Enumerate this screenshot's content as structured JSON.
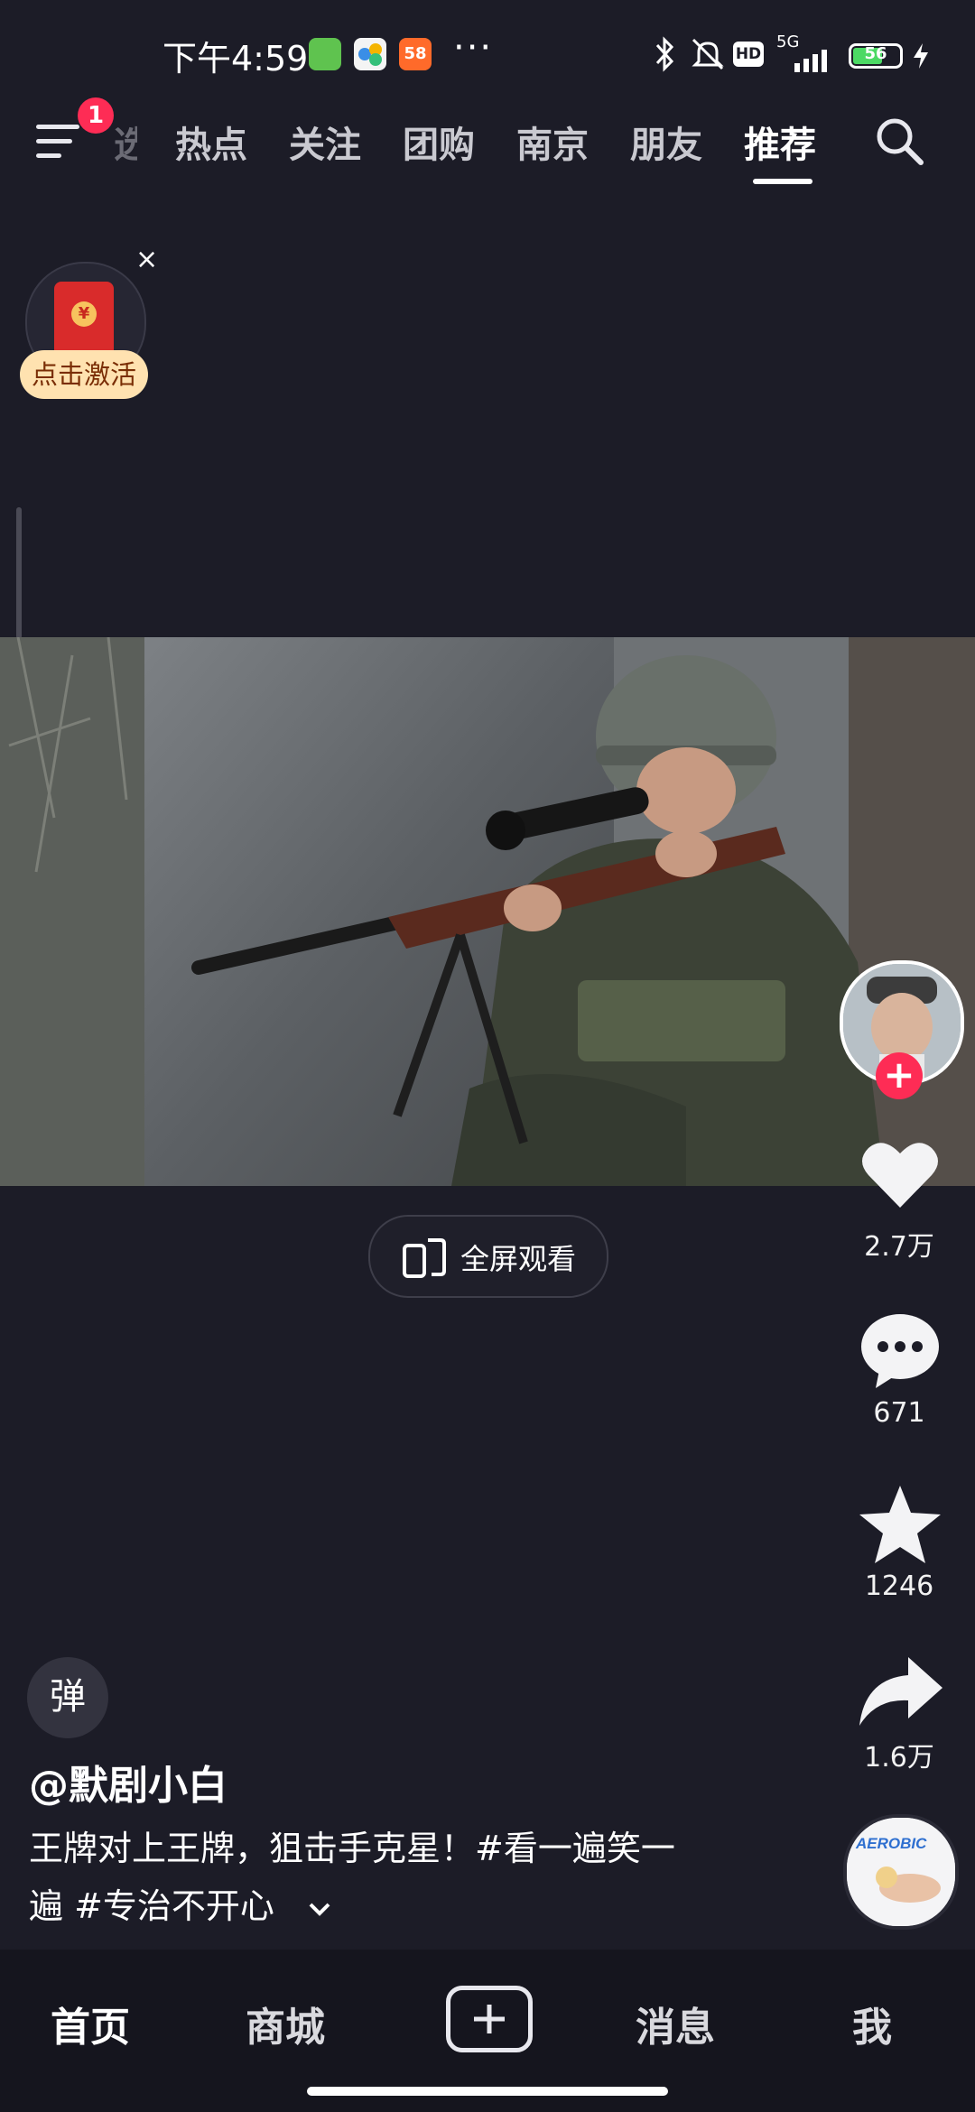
{
  "status_bar": {
    "time": "下午4:59",
    "battery": "56",
    "network": "5G",
    "hd": "HD",
    "more": "···"
  },
  "top_nav": {
    "menu_badge": "1",
    "partial_tab": "选",
    "tabs": [
      "热点",
      "关注",
      "团购",
      "南京",
      "朋友",
      "推荐"
    ],
    "active_tab": "推荐"
  },
  "red_packet": {
    "label": "点击激活",
    "close": "×",
    "coin": "¥"
  },
  "video": {
    "fullscreen_label": "全屏观看"
  },
  "actions": {
    "likes": "2.7万",
    "comments": "671",
    "favorites": "1246",
    "shares": "1.6万",
    "follow": "+"
  },
  "post": {
    "danmu": "弹",
    "author": "@默剧小白",
    "desc_line1": "王牌对上王牌，狙击手克星！#看一遍笑一",
    "desc_line2": "遍 #专治不开心",
    "music_text": "AEROBIC"
  },
  "bottom_nav": {
    "home": "首页",
    "mall": "商城",
    "messages": "消息",
    "me": "我"
  },
  "colors": {
    "background": "#1c1c27",
    "accent": "#fe2c55",
    "red_packet_pill": "#ffe2b0"
  }
}
